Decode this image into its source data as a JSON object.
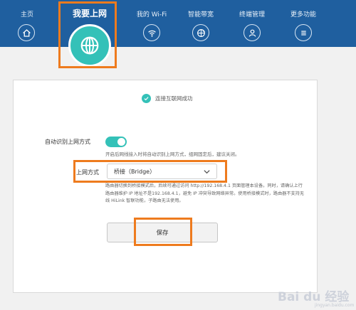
{
  "nav": {
    "items": [
      {
        "label": "主页",
        "icon": "home-icon"
      },
      {
        "label": "我要上网",
        "icon": "globe-icon"
      },
      {
        "label": "我的 Wi-Fi",
        "icon": "wifi-icon"
      },
      {
        "label": "智能带宽",
        "icon": "bandwidth-icon"
      },
      {
        "label": "终端管理",
        "icon": "user-icon"
      },
      {
        "label": "更多功能",
        "icon": "menu-icon"
      }
    ],
    "active_index": 1
  },
  "status": {
    "text": "连接互联网成功",
    "icon": "check-circle-icon"
  },
  "auto_detect": {
    "label": "自动识别上网方式",
    "enabled": true,
    "hint": "开启后网线接入时将自动识别上网方式，组网固定后，建议关闭。"
  },
  "mode": {
    "label": "上网方式",
    "selected": "桥接（Bridge）",
    "note": "路由器切换到桥接模式后，后续可通过访问 http://192.168.4.1 页面管理本设备。同时，请确认上行路由器维护 IP 地址不是192.168.4.1，避免 IP 冲突导致网络异常。使用桥接模式时，路由器不支持无线 HiLink 智联功能，子路由无法使用。"
  },
  "save_label": "保存",
  "watermark": {
    "main": "Bai du 经验",
    "sub": "jingyan.baidu.com"
  },
  "colors": {
    "header": "#1f5f9f",
    "accent": "#34c1b8",
    "highlight": "#ee7b1e"
  }
}
